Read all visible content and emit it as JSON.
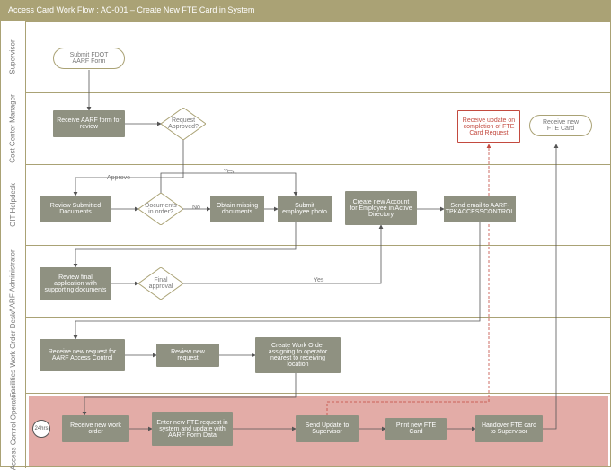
{
  "title": "Access Card Work Flow : AC-001 – Create New FTE Card in System",
  "lanes": {
    "l0": "Supervisor",
    "l1": "Cost Center Manager",
    "l2": "OIT Helpdesk",
    "l3": "AARF Administrator",
    "l4": "Facilities Work Order Desk",
    "l5": "Access Control Operator"
  },
  "nodes": {
    "start": "Submit FDOT AARF Form",
    "ccm1": "Receive AARF form for review",
    "dec1": "Request Approved?",
    "end1": "Receive update on completion of FTE Card Request",
    "end2": "Receive new FTE Card",
    "oit1": "Review Submitted Documents",
    "dec2": "Documents in order?",
    "oit2": "Obtain missing documents",
    "oit3": "Submit employee photo",
    "oit4": "Create new Account for Employee in Active Directory",
    "oit5": "Send email to AARF-TPKACCESSCONTROL",
    "aarf1": "Review final application with supporting documents",
    "dec3": "Final approval",
    "fac1": "Receive new request for AARF Access Control",
    "fac2": "Review new request",
    "fac3": "Create Work Order assigning to operator nearest to receiving location",
    "aco0": "24hrs",
    "aco1": "Receive new work order",
    "aco2": "Enter new FTE request in system and update with AARF Form Data",
    "aco3": "Send Update to Supervisor",
    "aco4": "Print new FTE Card",
    "aco5": "Handover FTE card to Supervisor"
  },
  "labels": {
    "approve": "Approve",
    "yes1": "Yes",
    "no": "No",
    "yes2": "Yes"
  },
  "chart_data": {
    "type": "swimlane-flowchart",
    "title": "Access Card Work Flow : AC-001 – Create New FTE Card in System",
    "lanes": [
      "Supervisor",
      "Cost Center Manager",
      "OIT Helpdesk",
      "AARF Administrator",
      "Facilities Work Order Desk",
      "Access Control Operator"
    ],
    "nodes": [
      {
        "id": "start",
        "lane": "Supervisor",
        "type": "start",
        "label": "Submit FDOT AARF Form"
      },
      {
        "id": "ccm1",
        "lane": "Cost Center Manager",
        "type": "process",
        "label": "Receive AARF form for review"
      },
      {
        "id": "dec1",
        "lane": "Cost Center Manager",
        "type": "decision",
        "label": "Request Approved?"
      },
      {
        "id": "end1",
        "lane": "Cost Center Manager",
        "type": "terminator",
        "label": "Receive update on completion of FTE Card Request"
      },
      {
        "id": "end2",
        "lane": "Cost Center Manager",
        "type": "terminator",
        "label": "Receive new FTE Card"
      },
      {
        "id": "oit1",
        "lane": "OIT Helpdesk",
        "type": "process",
        "label": "Review Submitted Documents"
      },
      {
        "id": "dec2",
        "lane": "OIT Helpdesk",
        "type": "decision",
        "label": "Documents in order?"
      },
      {
        "id": "oit2",
        "lane": "OIT Helpdesk",
        "type": "process",
        "label": "Obtain missing documents"
      },
      {
        "id": "oit3",
        "lane": "OIT Helpdesk",
        "type": "process",
        "label": "Submit employee photo"
      },
      {
        "id": "oit4",
        "lane": "OIT Helpdesk",
        "type": "process",
        "label": "Create new Account for Employee in Active Directory"
      },
      {
        "id": "oit5",
        "lane": "OIT Helpdesk",
        "type": "process",
        "label": "Send email to AARF-TPKACCESSCONTROL"
      },
      {
        "id": "aarf1",
        "lane": "AARF Administrator",
        "type": "process",
        "label": "Review final application with supporting documents"
      },
      {
        "id": "dec3",
        "lane": "AARF Administrator",
        "type": "decision",
        "label": "Final approval"
      },
      {
        "id": "fac1",
        "lane": "Facilities Work Order Desk",
        "type": "process",
        "label": "Receive new request for AARF Access Control"
      },
      {
        "id": "fac2",
        "lane": "Facilities Work Order Desk",
        "type": "process",
        "label": "Review new request"
      },
      {
        "id": "fac3",
        "lane": "Facilities Work Order Desk",
        "type": "process",
        "label": "Create Work Order assigning to operator nearest to receiving location"
      },
      {
        "id": "aco0",
        "lane": "Access Control Operator",
        "type": "timer",
        "label": "24hrs"
      },
      {
        "id": "aco1",
        "lane": "Access Control Operator",
        "type": "process",
        "label": "Receive new work order"
      },
      {
        "id": "aco2",
        "lane": "Access Control Operator",
        "type": "process",
        "label": "Enter new FTE request in system and update with AARF Form Data"
      },
      {
        "id": "aco3",
        "lane": "Access Control Operator",
        "type": "process",
        "label": "Send Update to Supervisor"
      },
      {
        "id": "aco4",
        "lane": "Access Control Operator",
        "type": "process",
        "label": "Print new FTE Card"
      },
      {
        "id": "aco5",
        "lane": "Access Control Operator",
        "type": "process",
        "label": "Handover FTE card to Supervisor"
      }
    ],
    "edges": [
      {
        "from": "start",
        "to": "ccm1"
      },
      {
        "from": "ccm1",
        "to": "dec1"
      },
      {
        "from": "dec1",
        "to": "oit1",
        "label": "Approve"
      },
      {
        "from": "oit1",
        "to": "dec2"
      },
      {
        "from": "dec2",
        "to": "oit2",
        "label": "No"
      },
      {
        "from": "dec2",
        "to": "oit3",
        "label": "Yes"
      },
      {
        "from": "oit2",
        "to": "oit3"
      },
      {
        "from": "oit3",
        "to": "aarf1"
      },
      {
        "from": "aarf1",
        "to": "dec3"
      },
      {
        "from": "dec3",
        "to": "oit4",
        "label": "Yes"
      },
      {
        "from": "oit4",
        "to": "oit5"
      },
      {
        "from": "oit5",
        "to": "fac1"
      },
      {
        "from": "fac1",
        "to": "fac2"
      },
      {
        "from": "fac2",
        "to": "fac3"
      },
      {
        "from": "fac3",
        "to": "aco1"
      },
      {
        "from": "aco1",
        "to": "aco2"
      },
      {
        "from": "aco2",
        "to": "aco3"
      },
      {
        "from": "aco3",
        "to": "aco4"
      },
      {
        "from": "aco4",
        "to": "aco5"
      },
      {
        "from": "aco3",
        "to": "end1",
        "style": "dashed"
      },
      {
        "from": "aco5",
        "to": "end2"
      }
    ]
  }
}
